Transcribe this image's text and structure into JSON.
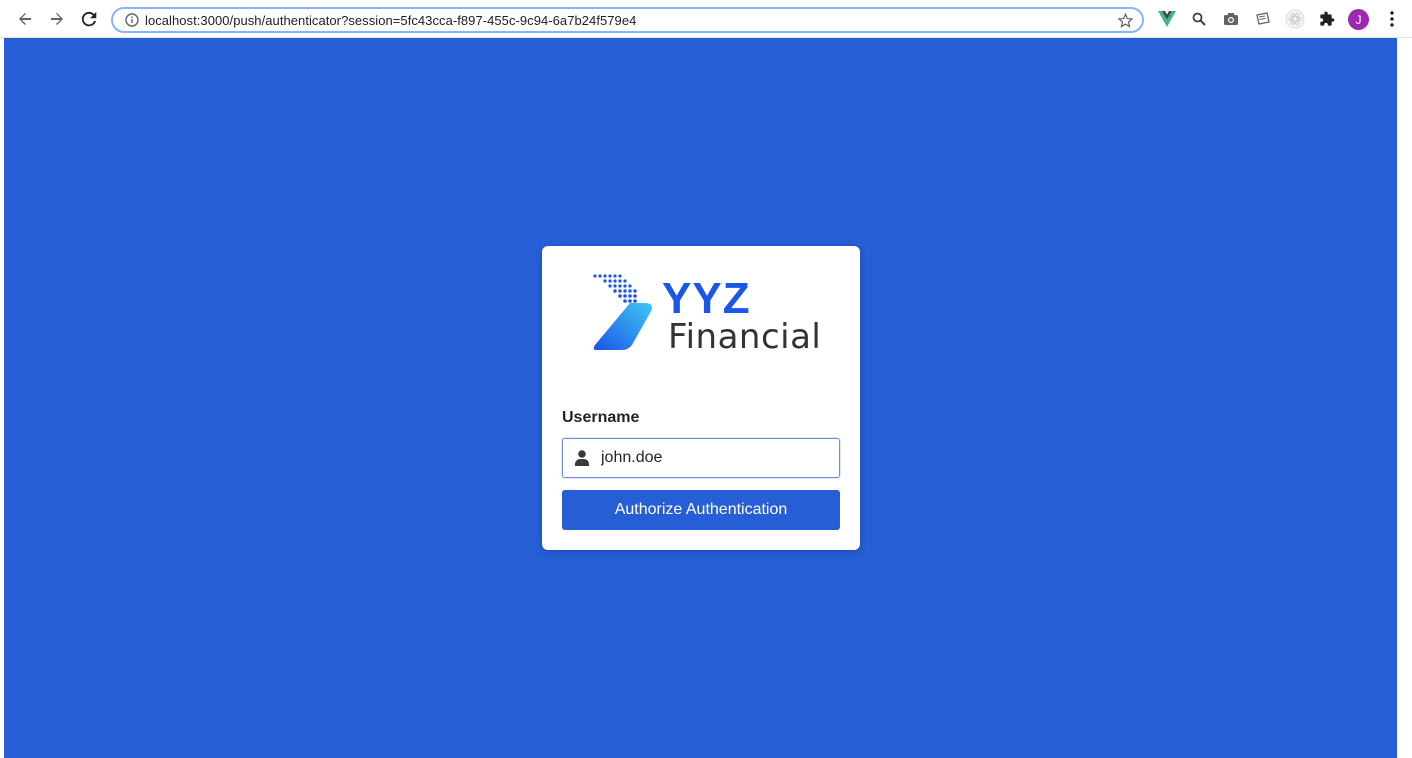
{
  "browser": {
    "url": "localhost:3000/push/authenticator?session=5fc43cca-f897-455c-9c94-6a7b24f579e4",
    "profile_initial": "J"
  },
  "logo": {
    "primary": "YYZ",
    "secondary": "Financial",
    "color": "#1a56e8"
  },
  "form": {
    "username_label": "Username",
    "username_value": "john.doe",
    "submit_label": "Authorize Authentication"
  },
  "colors": {
    "background": "#265ed6",
    "button": "#265ed6"
  }
}
